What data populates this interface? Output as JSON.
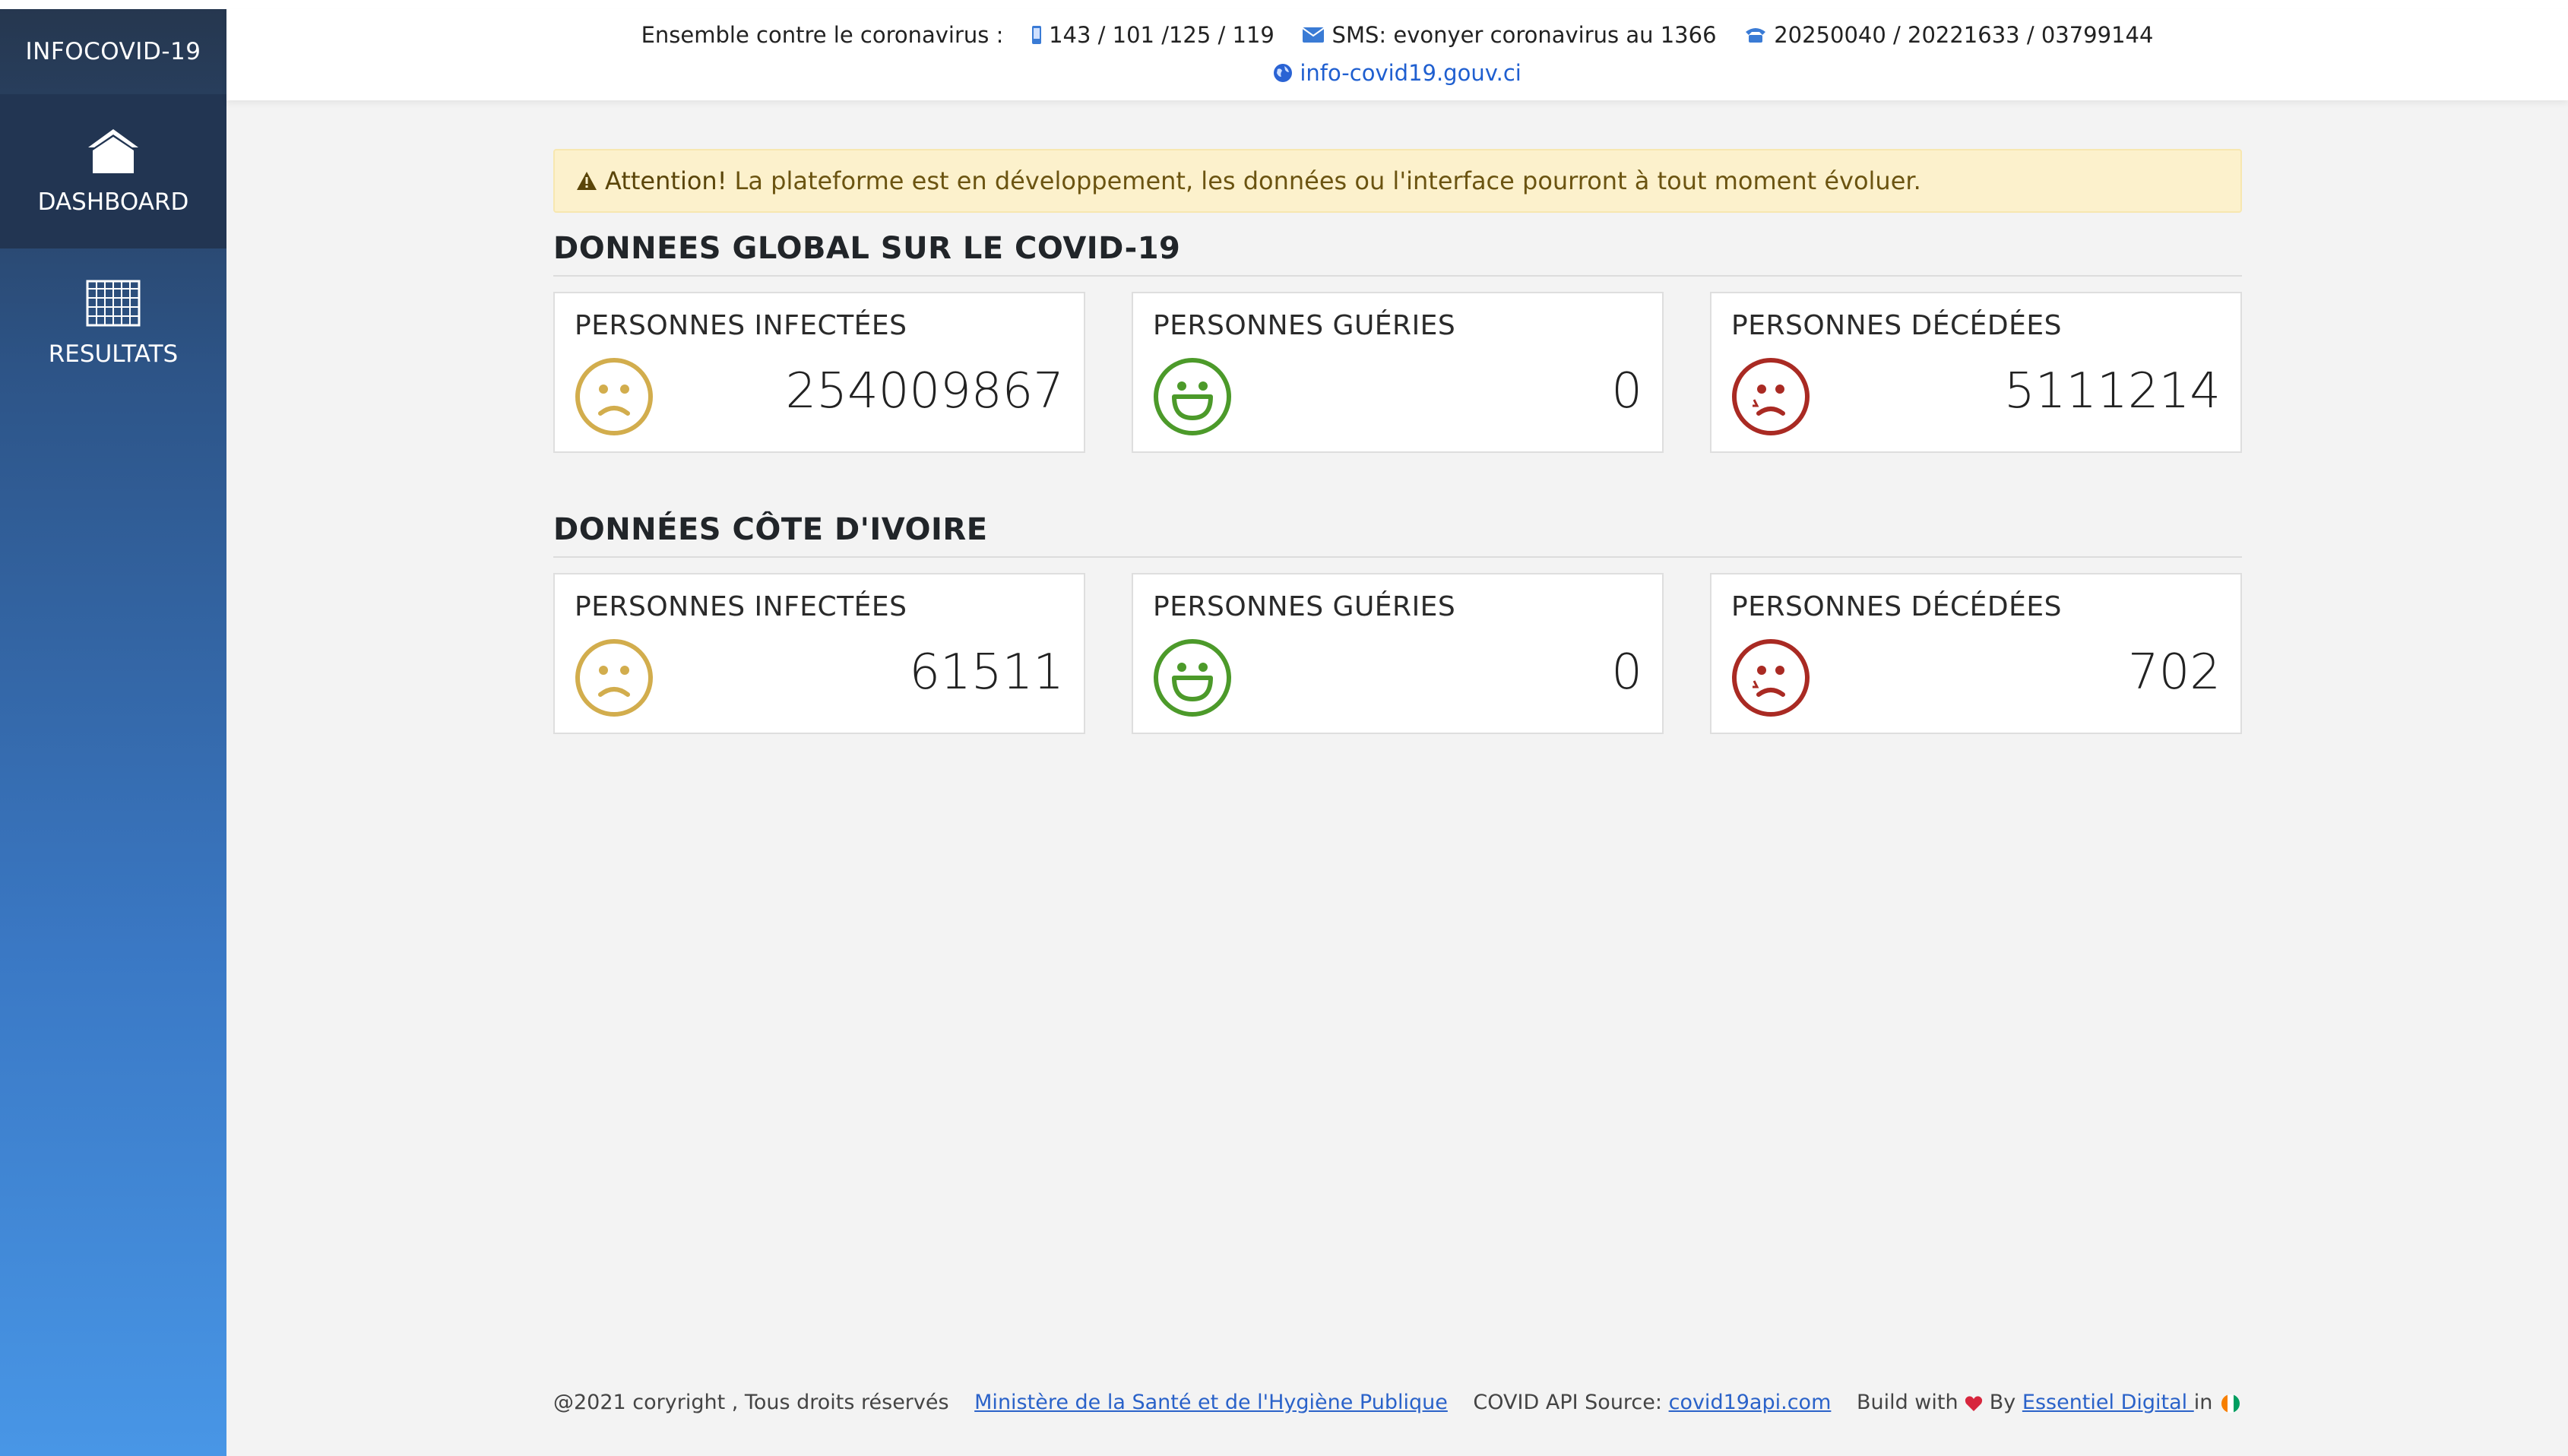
{
  "sidebar": {
    "brand": "INFOCOVID-19",
    "items": [
      {
        "label": "DASHBOARD",
        "icon": "home-icon",
        "active": true
      },
      {
        "label": "RESULTATS",
        "icon": "grid-icon",
        "active": false
      }
    ]
  },
  "header": {
    "intro": "Ensemble contre le coronavirus :",
    "phone_icon": "mobile-phone-icon",
    "phones": "143 / 101 /125 / 119",
    "mail_icon": "envelope-icon",
    "sms": "SMS: evonyer coronavirus au 1366",
    "tel_icon": "telephone-icon",
    "numbers": "20250040 / 20221633 / 03799144",
    "web_icon": "globe-icon",
    "website": "info-covid19.gouv.ci"
  },
  "alert": {
    "icon": "warning-icon",
    "strong": "Attention!",
    "text": "La plateforme est en développement, les données ou l'interface pourront à tout moment évoluer."
  },
  "sections": [
    {
      "title": "DONNEES GLOBAL SUR LE COVID-19",
      "cards": [
        {
          "label": "PERSONNES INFECTÉES",
          "value": "254009867",
          "face": "sad-face-icon",
          "color": "#d2ad4d"
        },
        {
          "label": "PERSONNES GUÉRIES",
          "value": "0",
          "face": "happy-face-icon",
          "color": "#4c9a2a"
        },
        {
          "label": "PERSONNES DÉCÉDÉES",
          "value": "5111214",
          "face": "crying-face-icon",
          "color": "#a92a23"
        }
      ]
    },
    {
      "title": "DONNÉES CÔTE D'IVOIRE",
      "cards": [
        {
          "label": "PERSONNES INFECTÉES",
          "value": "61511",
          "face": "sad-face-icon",
          "color": "#d2ad4d"
        },
        {
          "label": "PERSONNES GUÉRIES",
          "value": "0",
          "face": "happy-face-icon",
          "color": "#4c9a2a"
        },
        {
          "label": "PERSONNES DÉCÉDÉES",
          "value": "702",
          "face": "crying-face-icon",
          "color": "#a92a23"
        }
      ]
    }
  ],
  "footer": {
    "copyright": "@2021 coryright , Tous droits réservés",
    "ministry_link": "Ministère de la Santé et de l'Hygiène Publique",
    "api_prefix": "COVID API Source:",
    "api_link": "covid19api.com",
    "build_prefix": "Build with",
    "heart_icon": "heart-icon",
    "by": "By",
    "author_link": "Essentiel Digital ",
    "in": "in",
    "flag_icon": "ivory-coast-flag-icon"
  }
}
